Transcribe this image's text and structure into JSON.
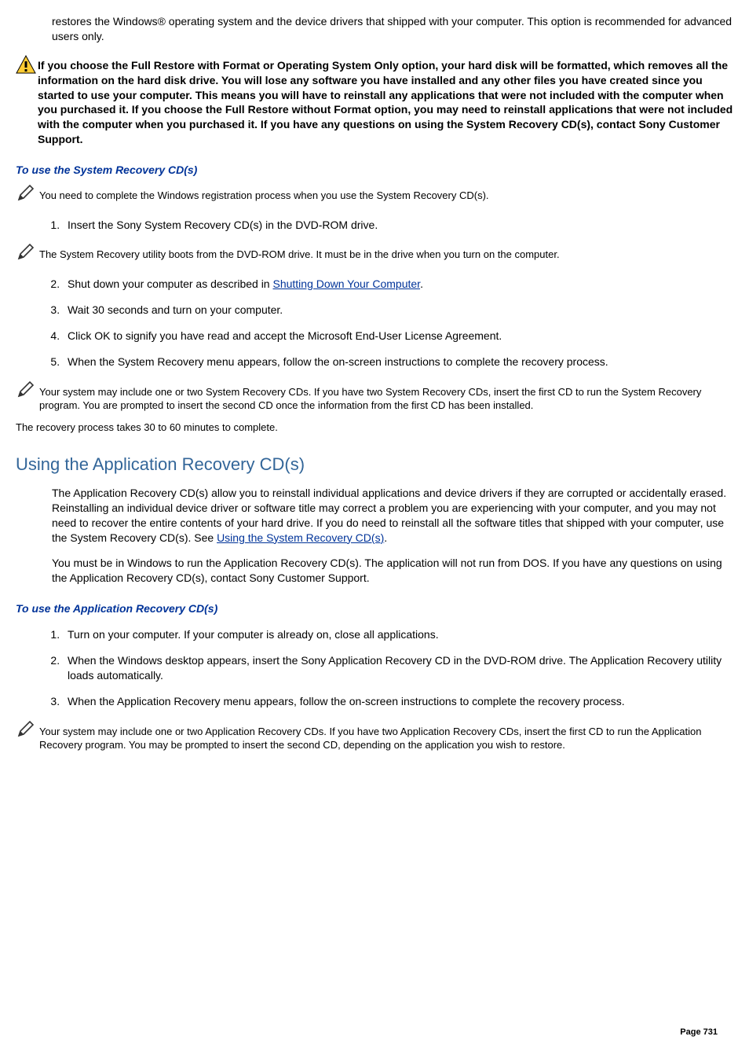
{
  "chart_data": null,
  "intro_paragraph": "restores the Windows® operating system and the device drivers that shipped with your computer. This option is recommended for advanced users only.",
  "warning_text": "If you choose the Full Restore with Format or Operating System Only option, your hard disk will be formatted, which removes all the information on the hard disk drive. You will lose any software you have installed and any other files you have created since you started to use your computer. This means you will have to reinstall any applications that were not included with the computer when you purchased it. If you choose the Full Restore without Format option, you may need to reinstall applications that were not included with the computer when you purchased it. If you have any questions on using the System Recovery CD(s), contact Sony Customer Support.",
  "section1": {
    "heading": "To use the System Recovery CD(s)",
    "note1": "You need to complete the Windows registration process when you use the System Recovery CD(s).",
    "step1": "Insert the Sony System Recovery CD(s) in the DVD-ROM drive.",
    "note2": "The System Recovery utility boots from the DVD-ROM drive. It must be in the drive when you turn on the computer.",
    "step2_pre": "Shut down your computer as described in ",
    "step2_link": "Shutting Down Your Computer",
    "step2_post": ".",
    "step3": "Wait 30 seconds and turn on your computer.",
    "step4": "Click OK to signify you have read and accept the Microsoft End-User License Agreement.",
    "step5": "When the System Recovery menu appears, follow the on-screen instructions to complete the recovery process.",
    "note3": "Your system may include one or two System Recovery CDs. If you have two System Recovery CDs, insert the first CD to run the System Recovery program. You are prompted to insert the second CD once the information from the first CD has been installed.",
    "closing": "The recovery process takes 30 to 60 minutes to complete."
  },
  "section2": {
    "heading": "Using the Application Recovery CD(s)",
    "para1_pre": "The Application Recovery CD(s) allow you to reinstall individual applications and device drivers if they are corrupted or accidentally erased. Reinstalling an individual device driver or software title may correct a problem you are experiencing with your computer, and you may not need to recover the entire contents of your hard drive. If you do need to reinstall all the software titles that shipped with your computer, use the System Recovery CD(s). See ",
    "para1_link": "Using the System Recovery CD(s)",
    "para1_post": ".",
    "para2": "You must be in Windows to run the Application Recovery CD(s). The application will not run from DOS. If you have any questions on using the Application Recovery CD(s), contact Sony Customer Support.",
    "subheading": "To use the Application Recovery CD(s)",
    "step1": "Turn on your computer. If your computer is already on, close all applications.",
    "step2": "When the Windows desktop appears, insert the Sony Application Recovery CD in the DVD-ROM drive. The Application Recovery utility loads automatically.",
    "step3": "When the Application Recovery menu appears, follow the on-screen instructions to complete the recovery process.",
    "note1": "Your system may include one or two Application Recovery CDs. If you have two Application Recovery CDs, insert the first CD to run the Application Recovery program. You may be prompted to insert the second CD, depending on the application you wish to restore."
  },
  "page_label": "Page 731"
}
